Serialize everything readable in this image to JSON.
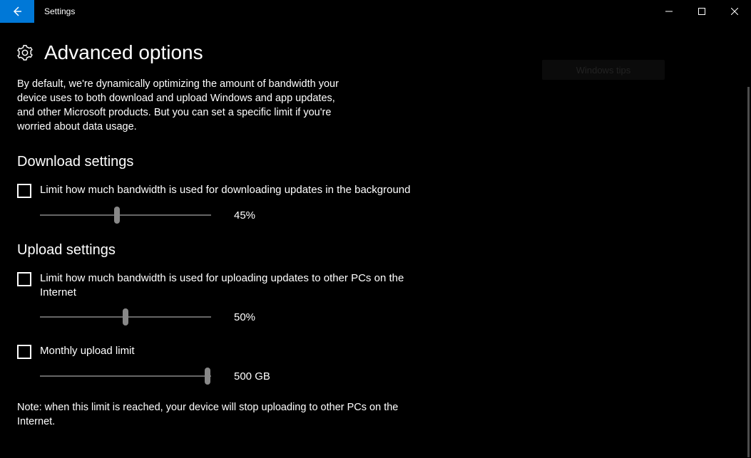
{
  "window": {
    "app_title": "Settings"
  },
  "page": {
    "title": "Advanced options",
    "intro": "By default, we're dynamically optimizing the amount of bandwidth your device uses to both download and upload Windows and app updates, and other Microsoft products. But you can set a specific limit if you're worried about data usage."
  },
  "tip": {
    "label": "Windows tips"
  },
  "download": {
    "heading": "Download settings",
    "limit_label": "Limit how much bandwidth is used for downloading updates in the background",
    "limit_checked": false,
    "slider_value": "45%",
    "slider_percent": 45
  },
  "upload": {
    "heading": "Upload settings",
    "limit_label": "Limit how much bandwidth is used for uploading updates to other PCs on the Internet",
    "limit_checked": false,
    "slider_value": "50%",
    "slider_percent": 50,
    "monthly_label": "Monthly upload limit",
    "monthly_checked": false,
    "monthly_value": "500 GB",
    "monthly_percent": 98
  },
  "note": "Note: when this limit is reached, your device will stop uploading to other PCs on the Internet."
}
